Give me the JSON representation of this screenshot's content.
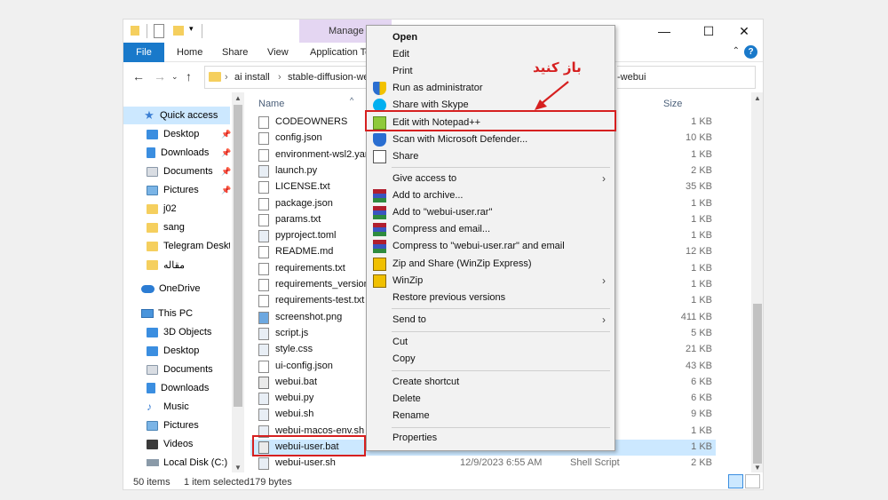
{
  "title_bar": {
    "manage_tab": "Manage",
    "window_controls": [
      "—",
      "☐",
      "✕"
    ]
  },
  "ribbon": {
    "tabs": [
      "File",
      "Home",
      "Share",
      "View",
      "Application To"
    ]
  },
  "address": {
    "crumbs": [
      "ai install",
      "›",
      "stable-diffusion-we"
    ],
    "tail": "-webui"
  },
  "nav_pane": {
    "items": [
      {
        "label": "Quick access",
        "icon": "star-icon",
        "selected": true
      },
      {
        "label": "Desktop",
        "icon": "desktop-icon",
        "pinned": true
      },
      {
        "label": "Downloads",
        "icon": "download-icon",
        "pinned": true
      },
      {
        "label": "Documents",
        "icon": "documents-icon",
        "pinned": true
      },
      {
        "label": "Pictures",
        "icon": "pictures-icon",
        "pinned": true
      },
      {
        "label": "j02",
        "icon": "folder-icon"
      },
      {
        "label": "sang",
        "icon": "folder-icon"
      },
      {
        "label": "Telegram Deskto",
        "icon": "folder-icon"
      },
      {
        "label": "مقاله",
        "icon": "folder-icon"
      },
      {
        "label": "OneDrive",
        "icon": "cloud-icon"
      },
      {
        "label": "This PC",
        "icon": "computer-icon"
      },
      {
        "label": "3D Objects",
        "icon": "cube-icon"
      },
      {
        "label": "Desktop",
        "icon": "desktop-icon"
      },
      {
        "label": "Documents",
        "icon": "documents-icon"
      },
      {
        "label": "Downloads",
        "icon": "download-icon"
      },
      {
        "label": "Music",
        "icon": "music-icon"
      },
      {
        "label": "Pictures",
        "icon": "pictures-icon"
      },
      {
        "label": "Videos",
        "icon": "videos-icon"
      },
      {
        "label": "Local Disk (C:)",
        "icon": "drive-icon"
      }
    ]
  },
  "file_list": {
    "columns": {
      "name": "Name",
      "size": "Size"
    },
    "rows": [
      {
        "name": "CODEOWNERS",
        "date": "",
        "type": "",
        "size": "1 KB"
      },
      {
        "name": "config.json",
        "date": "",
        "type": "er Effect...",
        "size": "10 KB"
      },
      {
        "name": "environment-wsl2.yam",
        "date": "",
        "type": "",
        "size": "1 KB"
      },
      {
        "name": "launch.py",
        "date": "",
        "type": "",
        "size": "2 KB"
      },
      {
        "name": "LICENSE.txt",
        "date": "",
        "type": "ment",
        "size": "35 KB"
      },
      {
        "name": "package.json",
        "date": "",
        "type": "er Effect...",
        "size": "1 KB"
      },
      {
        "name": "params.txt",
        "date": "",
        "type": "ment",
        "size": "1 KB"
      },
      {
        "name": "pyproject.toml",
        "date": "",
        "type": "",
        "size": "1 KB"
      },
      {
        "name": "README.md",
        "date": "",
        "type": "",
        "size": "12 KB"
      },
      {
        "name": "requirements.txt",
        "date": "",
        "type": "ment",
        "size": "1 KB"
      },
      {
        "name": "requirements_versions",
        "date": "",
        "type": "ment",
        "size": "1 KB"
      },
      {
        "name": "requirements-test.txt",
        "date": "",
        "type": "ment",
        "size": "1 KB"
      },
      {
        "name": "screenshot.png",
        "date": "",
        "type": "",
        "size": "411 KB"
      },
      {
        "name": "script.js",
        "date": "",
        "type": "File",
        "size": "5 KB"
      },
      {
        "name": "style.css",
        "date": "",
        "type": "Style S...",
        "size": "21 KB"
      },
      {
        "name": "ui-config.json",
        "date": "",
        "type": "er Effect...",
        "size": "43 KB"
      },
      {
        "name": "webui.bat",
        "date": "",
        "type": "atch File",
        "size": "6 KB"
      },
      {
        "name": "webui.py",
        "date": "",
        "type": "",
        "size": "6 KB"
      },
      {
        "name": "webui.sh",
        "date": "",
        "type": "",
        "size": "9 KB"
      },
      {
        "name": "webui-macos-env.sh",
        "date": "",
        "type": "",
        "size": "1 KB"
      },
      {
        "name": "webui-user.bat",
        "date": "",
        "type": "atch File",
        "size": "1 KB",
        "selected": true
      },
      {
        "name": "webui-user.sh",
        "date": "12/9/2023 6:55 AM",
        "type": "Shell Script",
        "size": "2 KB"
      }
    ]
  },
  "status_bar": {
    "item_count": "50 items",
    "selected": "1 item selected",
    "size": "179 bytes"
  },
  "context_menu": {
    "items": [
      {
        "label": "Open",
        "bold": true
      },
      {
        "label": "Edit"
      },
      {
        "label": "Print"
      },
      {
        "label": "Run as administrator",
        "icon": "shield-icon"
      },
      {
        "label": "Share with Skype",
        "icon": "skype-icon"
      },
      {
        "label": "Edit with Notepad++",
        "icon": "notepad-plus-plus-icon",
        "highlighted": true
      },
      {
        "label": "Scan with Microsoft Defender...",
        "icon": "defender-icon"
      },
      {
        "label": "Share",
        "icon": "share-icon"
      },
      {
        "label": "Give access to",
        "submenu": true
      },
      {
        "label": "Add to archive...",
        "icon": "winrar-icon"
      },
      {
        "label": "Add to \"webui-user.rar\"",
        "icon": "winrar-icon"
      },
      {
        "label": "Compress and email...",
        "icon": "winrar-icon"
      },
      {
        "label": "Compress to \"webui-user.rar\" and email",
        "icon": "winrar-icon"
      },
      {
        "label": "Zip and Share (WinZip Express)",
        "icon": "winzip-icon"
      },
      {
        "label": "WinZip",
        "icon": "winzip-icon",
        "submenu": true
      },
      {
        "label": "Restore previous versions"
      },
      {
        "label": "Send to",
        "submenu": true
      },
      {
        "label": "Cut"
      },
      {
        "label": "Copy"
      },
      {
        "label": "Create shortcut"
      },
      {
        "label": "Delete"
      },
      {
        "label": "Rename"
      },
      {
        "label": "Properties"
      }
    ]
  },
  "annotation": {
    "text": "باز کنید",
    "color": "#d62020"
  },
  "colors": {
    "accent": "#1979ca",
    "selection": "#cce8ff",
    "manage_tab": "#e4d6f2",
    "annotation": "#d62020"
  }
}
